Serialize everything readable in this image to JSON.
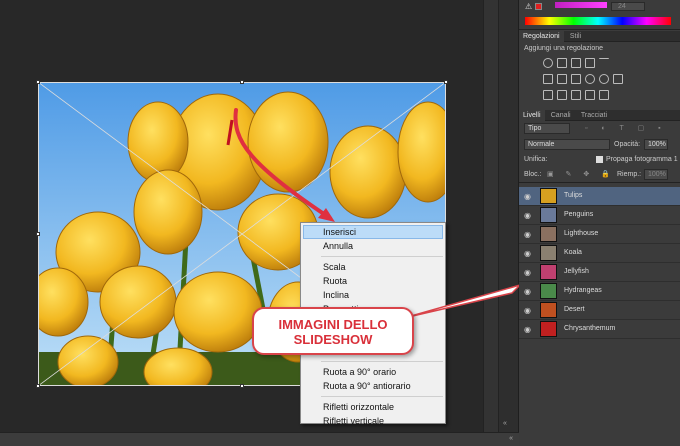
{
  "image": {
    "description_hidden": ""
  },
  "context_menu": {
    "items": [
      {
        "label": "Inserisci",
        "highlighted": true
      },
      {
        "label": "Annulla"
      },
      {
        "sep": true
      },
      {
        "label": "Scala"
      },
      {
        "label": "Ruota"
      },
      {
        "label": "Inclina"
      },
      {
        "label": "Prospetti"
      },
      {
        "label": ""
      },
      {
        "label": ""
      },
      {
        "label": ""
      },
      {
        "sep": true
      },
      {
        "label": "Ruota a 90° orario"
      },
      {
        "label": "Ruota a 90° antiorario"
      },
      {
        "sep": true
      },
      {
        "label": "Rifletti orizzontale"
      },
      {
        "label": "Rifletti verticale"
      }
    ]
  },
  "callout": {
    "line1": "IMMAGINI DELLO",
    "line2": "SLIDESHOW"
  },
  "color_panel": {
    "value": "24"
  },
  "adjust_panel": {
    "tabs": [
      "Regolazioni",
      "Stili"
    ],
    "title": "Aggiungi una regolazione"
  },
  "layers_panel": {
    "tabs": [
      "Livelli",
      "Canali",
      "Tracciati"
    ],
    "filter_label": "Tipo",
    "blend_mode": "Normale",
    "opacity_label": "Opacità:",
    "opacity_value": "100%",
    "unify_label": "Unifica:",
    "propagate_label": "Propaga fotogramma 1",
    "lock_label": "Bloc.:",
    "fill_label": "Riemp.:",
    "fill_value": "100%",
    "layers": [
      {
        "name": "Tulips",
        "selected": true,
        "color": "#d6a020"
      },
      {
        "name": "Penguins",
        "color": "#6a7a9a"
      },
      {
        "name": "Lighthouse",
        "color": "#8a7060"
      },
      {
        "name": "Koala",
        "color": "#8a8070"
      },
      {
        "name": "Jellyfish",
        "color": "#c04070"
      },
      {
        "name": "Hydrangeas",
        "color": "#4a8a4a"
      },
      {
        "name": "Desert",
        "color": "#c05020"
      },
      {
        "name": "Chrysanthemum",
        "color": "#c02020"
      }
    ]
  },
  "accent_colors": {
    "callout_red": "#d9444a",
    "selection_blue": "#506480",
    "menu_highlight": "#bcdcf8"
  }
}
